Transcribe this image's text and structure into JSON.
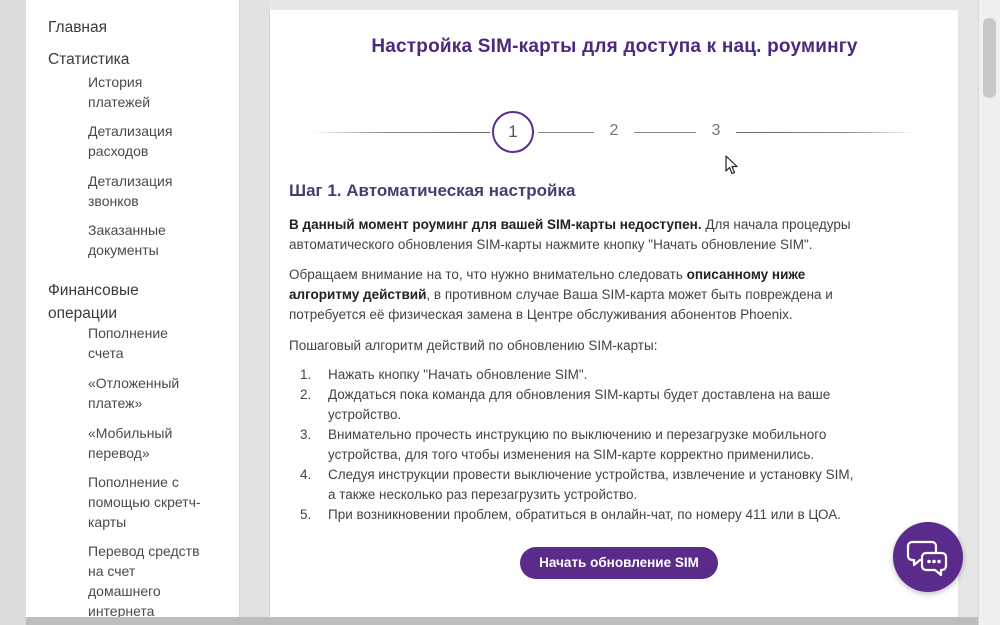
{
  "sidebar": {
    "main": "Главная",
    "statistics": "Статистика",
    "stat_items": [
      {
        "l1": "История",
        "l2": "платежей"
      },
      {
        "l1": "Детализация",
        "l2": "расходов"
      },
      {
        "l1": "Детализация",
        "l2": "звонков"
      },
      {
        "l1": "Заказанные",
        "l2": "документы"
      }
    ],
    "finance_l1": "Финансовые",
    "finance_l2": "операции",
    "fin_items": [
      {
        "l1": "Пополнение",
        "l2": "счета"
      },
      {
        "l1": "«Отложенный",
        "l2": "платеж»"
      },
      {
        "l1": "«Мобильный",
        "l2": "перевод»"
      },
      {
        "l1": "Пополнение с",
        "l2": "помощью скретч-",
        "l3": "карты"
      },
      {
        "l1": "Перевод средств",
        "l2": "на счет",
        "l3": "домашнего",
        "l4": "интернета"
      }
    ]
  },
  "main": {
    "title": "Настройка SIM-карты для доступа к нац. роумингу",
    "steps": [
      "1",
      "2",
      "3"
    ],
    "active_step": 1,
    "step_heading": "Шаг 1. Автоматическая настройка",
    "p1_bold": "В данный момент роуминг для вашей SIM-карты недоступен.",
    "p1_rest_a": " Для начала процедуры",
    "p1_line2": "автоматического обновления SIM-карты нажмите кнопку \"Начать обновление SIM\".",
    "p2_a": "Обращаем внимание на то, что нужно внимательно следовать ",
    "p2_bold_a": "описанному ниже",
    "p2_bold_b": "алгоритму действий",
    "p2_b": ", в противном случае Ваша SIM-карта может быть повреждена и",
    "p2_line3": "потребуется её физическая замена в Центре обслуживания абонентов Phoenix.",
    "p3": "Пошаговый алгоритм действий по обновлению SIM-карты:",
    "list": [
      {
        "num": "1.",
        "l1": "Нажать кнопку \"Начать обновление SIM\"."
      },
      {
        "num": "2.",
        "l1": "Дождаться пока команда для обновления SIM-карты будет доставлена на ваше",
        "l2": "устройство."
      },
      {
        "num": "3.",
        "l1": "Внимательно прочесть инструкцию по выключению и перезагрузке мобильного",
        "l2": "устройства, для того чтобы изменения на SIM-карте корректно применились."
      },
      {
        "num": "4.",
        "l1": "Следуя инструкции провести выключение устройства, извлечение и установку SIM,",
        "l2": "а также несколько раз перезагрузить устройство."
      },
      {
        "num": "5.",
        "l1": "При возникновении проблем, обратиться в онлайн-чат, по номеру 411 или в ЦОА."
      }
    ],
    "button_label": "Начать обновление SIM"
  },
  "colors": {
    "accent": "#5b2b8c",
    "title": "#4b2a7e"
  },
  "icons": {
    "chat": "chat-bubbles-icon",
    "cursor": "mouse-pointer-icon"
  }
}
